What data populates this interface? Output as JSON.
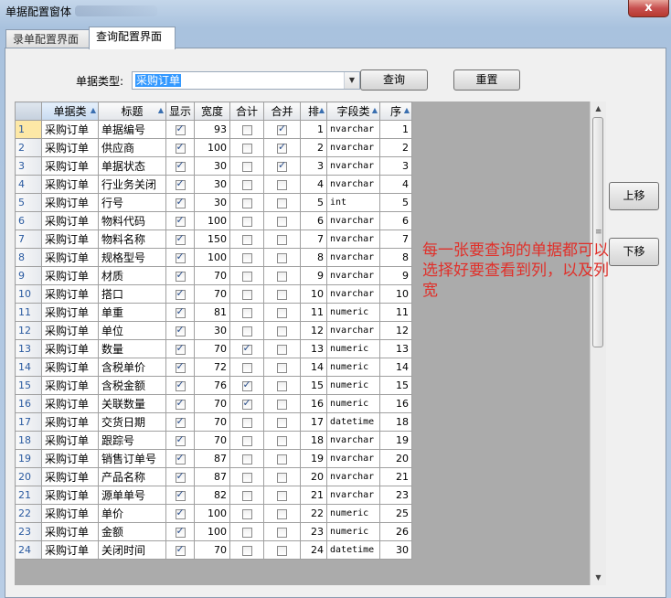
{
  "window": {
    "title": "单据配置窗体",
    "close_glyph": "x"
  },
  "tabs": [
    {
      "label": "录单配置界面"
    },
    {
      "label": "查询配置界面"
    }
  ],
  "filter": {
    "doc_type_label": "单据类型:",
    "doc_type_value": "采购订单",
    "query_label": "查询",
    "reset_label": "重置"
  },
  "side_buttons": {
    "up_label": "上移",
    "down_label": "下移"
  },
  "note": "每一张要查询的单据都可以选择好要查看到列，以及列宽",
  "grid": {
    "headers": [
      "单据类",
      "标题",
      "显示",
      "宽度",
      "合计",
      "合并",
      "排",
      "字段类",
      "序"
    ],
    "rows": [
      {
        "n": "1",
        "doc": "采购订单",
        "title": "单据编号",
        "show": true,
        "width": "93",
        "sum": false,
        "merge": true,
        "sort": "1",
        "type": "nvarchar",
        "seq": "1"
      },
      {
        "n": "2",
        "doc": "采购订单",
        "title": "供应商",
        "show": true,
        "width": "100",
        "sum": false,
        "merge": true,
        "sort": "2",
        "type": "nvarchar",
        "seq": "2"
      },
      {
        "n": "3",
        "doc": "采购订单",
        "title": "单据状态",
        "show": true,
        "width": "30",
        "sum": false,
        "merge": true,
        "sort": "3",
        "type": "nvarchar",
        "seq": "3"
      },
      {
        "n": "4",
        "doc": "采购订单",
        "title": "行业务关闭",
        "show": true,
        "width": "30",
        "sum": false,
        "merge": false,
        "sort": "4",
        "type": "nvarchar",
        "seq": "4"
      },
      {
        "n": "5",
        "doc": "采购订单",
        "title": "行号",
        "show": true,
        "width": "30",
        "sum": false,
        "merge": false,
        "sort": "5",
        "type": "int",
        "seq": "5"
      },
      {
        "n": "6",
        "doc": "采购订单",
        "title": "物料代码",
        "show": true,
        "width": "100",
        "sum": false,
        "merge": false,
        "sort": "6",
        "type": "nvarchar",
        "seq": "6"
      },
      {
        "n": "7",
        "doc": "采购订单",
        "title": "物料名称",
        "show": true,
        "width": "150",
        "sum": false,
        "merge": false,
        "sort": "7",
        "type": "nvarchar",
        "seq": "7"
      },
      {
        "n": "8",
        "doc": "采购订单",
        "title": "规格型号",
        "show": true,
        "width": "100",
        "sum": false,
        "merge": false,
        "sort": "8",
        "type": "nvarchar",
        "seq": "8"
      },
      {
        "n": "9",
        "doc": "采购订单",
        "title": "材质",
        "show": true,
        "width": "70",
        "sum": false,
        "merge": false,
        "sort": "9",
        "type": "nvarchar",
        "seq": "9"
      },
      {
        "n": "10",
        "doc": "采购订单",
        "title": "搭口",
        "show": true,
        "width": "70",
        "sum": false,
        "merge": false,
        "sort": "10",
        "type": "nvarchar",
        "seq": "10"
      },
      {
        "n": "11",
        "doc": "采购订单",
        "title": "单重",
        "show": true,
        "width": "81",
        "sum": false,
        "merge": false,
        "sort": "11",
        "type": "numeric",
        "seq": "11"
      },
      {
        "n": "12",
        "doc": "采购订单",
        "title": "单位",
        "show": true,
        "width": "30",
        "sum": false,
        "merge": false,
        "sort": "12",
        "type": "nvarchar",
        "seq": "12"
      },
      {
        "n": "13",
        "doc": "采购订单",
        "title": "数量",
        "show": true,
        "width": "70",
        "sum": true,
        "merge": false,
        "sort": "13",
        "type": "numeric",
        "seq": "13"
      },
      {
        "n": "14",
        "doc": "采购订单",
        "title": "含税单价",
        "show": true,
        "width": "72",
        "sum": false,
        "merge": false,
        "sort": "14",
        "type": "numeric",
        "seq": "14"
      },
      {
        "n": "15",
        "doc": "采购订单",
        "title": "含税金额",
        "show": true,
        "width": "76",
        "sum": true,
        "merge": false,
        "sort": "15",
        "type": "numeric",
        "seq": "15"
      },
      {
        "n": "16",
        "doc": "采购订单",
        "title": "关联数量",
        "show": true,
        "width": "70",
        "sum": true,
        "merge": false,
        "sort": "16",
        "type": "numeric",
        "seq": "16"
      },
      {
        "n": "17",
        "doc": "采购订单",
        "title": "交货日期",
        "show": true,
        "width": "70",
        "sum": false,
        "merge": false,
        "sort": "17",
        "type": "datetime",
        "seq": "18"
      },
      {
        "n": "18",
        "doc": "采购订单",
        "title": "跟踪号",
        "show": true,
        "width": "70",
        "sum": false,
        "merge": false,
        "sort": "18",
        "type": "nvarchar",
        "seq": "19"
      },
      {
        "n": "19",
        "doc": "采购订单",
        "title": "销售订单号",
        "show": true,
        "width": "87",
        "sum": false,
        "merge": false,
        "sort": "19",
        "type": "nvarchar",
        "seq": "20"
      },
      {
        "n": "20",
        "doc": "采购订单",
        "title": "产品名称",
        "show": true,
        "width": "87",
        "sum": false,
        "merge": false,
        "sort": "20",
        "type": "nvarchar",
        "seq": "21"
      },
      {
        "n": "21",
        "doc": "采购订单",
        "title": "源单单号",
        "show": true,
        "width": "82",
        "sum": false,
        "merge": false,
        "sort": "21",
        "type": "nvarchar",
        "seq": "23"
      },
      {
        "n": "22",
        "doc": "采购订单",
        "title": "单价",
        "show": true,
        "width": "100",
        "sum": false,
        "merge": false,
        "sort": "22",
        "type": "numeric",
        "seq": "25"
      },
      {
        "n": "23",
        "doc": "采购订单",
        "title": "金额",
        "show": true,
        "width": "100",
        "sum": false,
        "merge": false,
        "sort": "23",
        "type": "numeric",
        "seq": "26"
      },
      {
        "n": "24",
        "doc": "采购订单",
        "title": "关闭时间",
        "show": true,
        "width": "70",
        "sum": false,
        "merge": false,
        "sort": "24",
        "type": "datetime",
        "seq": "30"
      }
    ]
  }
}
